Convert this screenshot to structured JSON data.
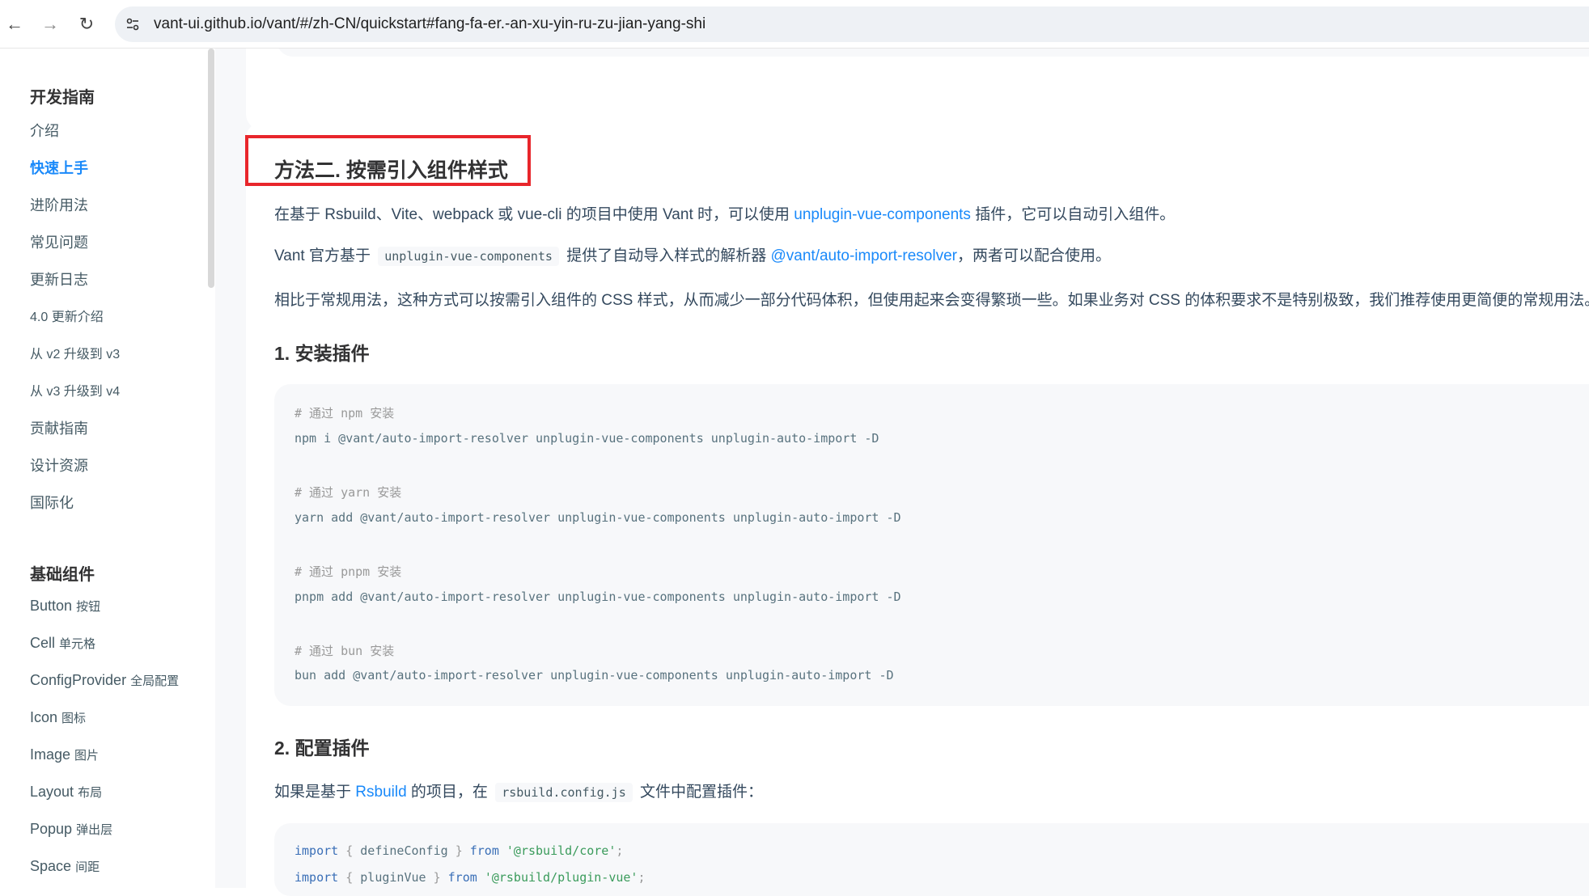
{
  "browser": {
    "url": "vant-ui.github.io/vant/#/zh-CN/quickstart#fang-fa-er.-an-xu-yin-ru-zu-jian-yang-shi",
    "back_icon": "←",
    "forward_icon": "→",
    "reload_icon": "↻"
  },
  "sidebar": {
    "group1_title": "开发指南",
    "group1_items": [
      "介绍",
      "快速上手",
      "进阶用法",
      "常见问题",
      "更新日志",
      "4.0 更新介绍",
      "从 v2 升级到 v3",
      "从 v3 升级到 v4",
      "贡献指南",
      "设计资源",
      "国际化"
    ],
    "group2_title": "基础组件",
    "group2_items": [
      {
        "en": "Button",
        "zh": "按钮"
      },
      {
        "en": "Cell",
        "zh": "单元格"
      },
      {
        "en": "ConfigProvider",
        "zh": "全局配置"
      },
      {
        "en": "Icon",
        "zh": "图标"
      },
      {
        "en": "Image",
        "zh": "图片"
      },
      {
        "en": "Layout",
        "zh": "布局"
      },
      {
        "en": "Popup",
        "zh": "弹出层"
      },
      {
        "en": "Space",
        "zh": "间距"
      }
    ]
  },
  "content": {
    "heading": "方法二. 按需引入组件样式",
    "p1_before": "在基于 Rsbuild、Vite、webpack 或 vue-cli 的项目中使用 Vant 时，可以使用 ",
    "p1_link": "unplugin-vue-components",
    "p1_after": " 插件，它可以自动引入组件。",
    "p2_before": "Vant 官方基于 ",
    "p2_code": "unplugin-vue-components",
    "p2_mid": " 提供了自动导入样式的解析器 ",
    "p2_link": "@vant/auto-import-resolver",
    "p2_after": "，两者可以配合使用。",
    "p3": "相比于常规用法，这种方式可以按需引入组件的 CSS 样式，从而减少一部分代码体积，但使用起来会变得繁琐一些。如果业务对 CSS 的体积要求不是特别极致，我们推荐使用更简便的常规用法。",
    "step1_title": "1. 安装插件",
    "install_code": [
      {
        "type": "comment",
        "text": "# 通过 npm 安装"
      },
      {
        "type": "code",
        "text": "npm i @vant/auto-import-resolver unplugin-vue-components unplugin-auto-import -D"
      },
      {
        "type": "comment",
        "text": "# 通过 yarn 安装"
      },
      {
        "type": "code",
        "text": "yarn add @vant/auto-import-resolver unplugin-vue-components unplugin-auto-import -D"
      },
      {
        "type": "comment",
        "text": "# 通过 pnpm 安装"
      },
      {
        "type": "code",
        "text": "pnpm add @vant/auto-import-resolver unplugin-vue-components unplugin-auto-import -D"
      },
      {
        "type": "comment",
        "text": "# 通过 bun 安装"
      },
      {
        "type": "code",
        "text": "bun add @vant/auto-import-resolver unplugin-vue-components unplugin-auto-import -D"
      }
    ],
    "step2_title": "2. 配置插件",
    "p4_before": "如果是基于 ",
    "p4_link": "Rsbuild",
    "p4_mid": " 的项目，在 ",
    "p4_code": "rsbuild.config.js",
    "p4_after": " 文件中配置插件：",
    "config_line1": {
      "kw1": "import",
      "ob": "{",
      "name": "defineConfig",
      "cb": "}",
      "kw2": "from",
      "str": "'@rsbuild/core'",
      "end": ";"
    },
    "config_line2": {
      "kw1": "import",
      "ob": "{",
      "name": "pluginVue",
      "cb": "}",
      "kw2": "from",
      "str": "'@rsbuild/plugin-vue'",
      "end": ";"
    }
  },
  "colors": {
    "accent": "#1989fa",
    "highlight_border": "#e8262b"
  }
}
